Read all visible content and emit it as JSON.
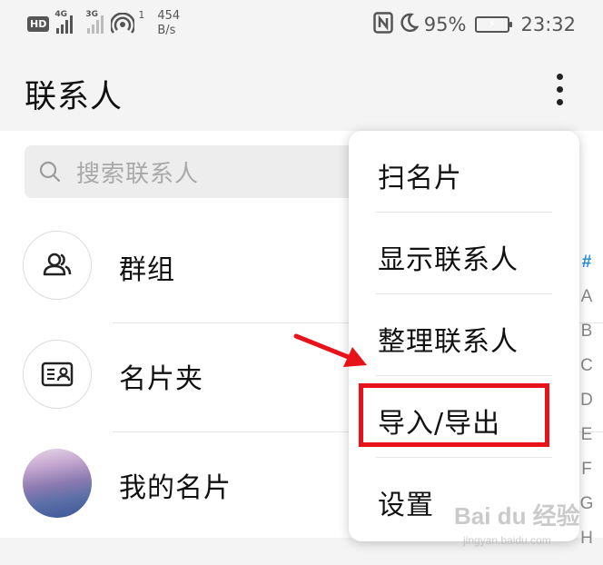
{
  "status_bar": {
    "hd": "HD",
    "sim1_network": "4G",
    "sim2_network": "3G",
    "wifi_sup": "1",
    "speed_value": "454",
    "speed_unit": "B/s",
    "battery_percent": "95%",
    "time": "23:32"
  },
  "header": {
    "title": "联系人"
  },
  "search": {
    "placeholder": "搜索联系人"
  },
  "contacts_list": [
    {
      "label": "群组",
      "icon": "group-icon"
    },
    {
      "label": "名片夹",
      "icon": "card-holder-icon"
    },
    {
      "label": "我的名片",
      "icon": "avatar-photo"
    }
  ],
  "alphabet_index": [
    "#",
    "A",
    "B",
    "C",
    "D",
    "E",
    "F",
    "G",
    "H"
  ],
  "menu": {
    "items": [
      "扫名片",
      "显示联系人",
      "整理联系人",
      "导入/导出",
      "设置"
    ],
    "highlighted": "导入/导出"
  },
  "colors": {
    "accent": "#1e8fd8",
    "highlight_red": "#e8121a"
  },
  "watermark": {
    "brand": "Bai du 经验",
    "url": "jingyan.baidu.com"
  }
}
